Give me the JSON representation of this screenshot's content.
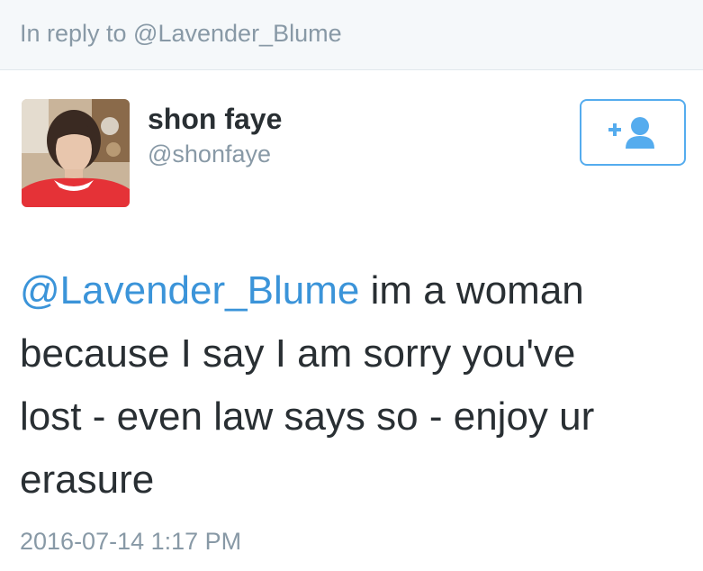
{
  "reply_context": {
    "text": "In reply to @Lavender_Blume"
  },
  "author": {
    "display_name": "shon faye",
    "handle": "@shonfaye"
  },
  "follow_button": {
    "icon": "follow-user-icon"
  },
  "tweet": {
    "mention": "@Lavender_Blume",
    "line1": " im a woman",
    "line2": "because I say I am sorry you've",
    "line3": "lost - even law says so - enjoy ur",
    "line4": "erasure"
  },
  "timestamp": "2016-07-14 1:17 PM",
  "colors": {
    "link": "#3b94d9",
    "follow_accent": "#55acee",
    "muted": "#8899a6",
    "text": "#292f33"
  }
}
